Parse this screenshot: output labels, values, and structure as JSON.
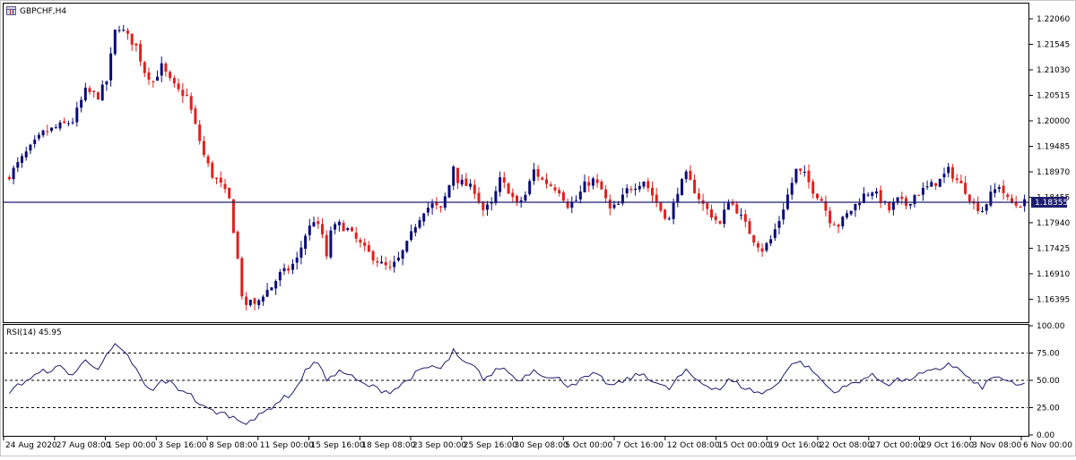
{
  "window": {
    "title": "GBPCHF,H4",
    "icon": "chart-window-icon"
  },
  "colors": {
    "bull": "#0b0b7d",
    "bear": "#e0201c",
    "line": "#1c1c6e",
    "frame": "#000000",
    "bg": "#ffffff",
    "current_price_bg": "#1c1c6e",
    "current_price_text": "#ffffff"
  },
  "chart_data": [
    {
      "type": "candlestick",
      "title": "GBPCHF,H4",
      "symbol": "GBPCHF",
      "timeframe": "H4",
      "ylim": [
        1.1595,
        1.2235
      ],
      "y_ticks": [
        "1.22060",
        "1.21545",
        "1.21030",
        "1.20515",
        "1.20000",
        "1.19485",
        "1.18970",
        "1.18455",
        "1.17940",
        "1.17425",
        "1.16910",
        "1.16395"
      ],
      "current_price": 1.18355,
      "current_price_label": "1.18355",
      "grid": false,
      "x_ticks": [
        "24 Aug 2020",
        "27 Aug 08:00",
        "1 Sep 00:00",
        "3 Sep 16:00",
        "8 Sep 08:00",
        "11 Sep 00:00",
        "15 Sep 16:00",
        "18 Sep 08:00",
        "23 Sep 00:00",
        "25 Sep 16:00",
        "30 Sep 08:00",
        "5 Oct 00:00",
        "7 Oct 16:00",
        "12 Oct 08:00",
        "15 Oct 00:00",
        "19 Oct 16:00",
        "22 Oct 08:00",
        "27 Oct 00:00",
        "29 Oct 16:00",
        "3 Nov 08:00",
        "6 Nov 00:00"
      ],
      "close_path": [
        [
          0,
          1.189
        ],
        [
          4,
          1.1935
        ],
        [
          8,
          1.1975
        ],
        [
          12,
          1.199
        ],
        [
          15,
          1.2
        ],
        [
          18,
          1.206
        ],
        [
          21,
          1.205
        ],
        [
          23,
          1.208
        ],
        [
          25,
          1.218
        ],
        [
          26,
          1.219
        ],
        [
          28,
          1.217
        ],
        [
          30,
          1.215
        ],
        [
          32,
          1.21
        ],
        [
          34,
          1.208
        ],
        [
          36,
          1.211
        ],
        [
          38,
          1.208
        ],
        [
          40,
          1.206
        ],
        [
          42,
          1.205
        ],
        [
          44,
          1.199
        ],
        [
          46,
          1.193
        ],
        [
          48,
          1.189
        ],
        [
          50,
          1.187
        ],
        [
          52,
          1.184
        ],
        [
          54,
          1.172
        ],
        [
          55,
          1.165
        ],
        [
          56,
          1.162
        ],
        [
          57,
          1.164
        ],
        [
          58,
          1.1625
        ],
        [
          60,
          1.165
        ],
        [
          62,
          1.1665
        ],
        [
          64,
          1.169
        ],
        [
          66,
          1.17
        ],
        [
          68,
          1.172
        ],
        [
          70,
          1.177
        ],
        [
          72,
          1.18
        ],
        [
          74,
          1.177
        ],
        [
          75,
          1.172
        ],
        [
          76,
          1.178
        ],
        [
          78,
          1.179
        ],
        [
          80,
          1.178
        ],
        [
          82,
          1.176
        ],
        [
          84,
          1.174
        ],
        [
          86,
          1.1725
        ],
        [
          88,
          1.171
        ],
        [
          90,
          1.17
        ],
        [
          92,
          1.172
        ],
        [
          94,
          1.175
        ],
        [
          96,
          1.179
        ],
        [
          98,
          1.182
        ],
        [
          100,
          1.183
        ],
        [
          102,
          1.182
        ],
        [
          104,
          1.187
        ],
        [
          105,
          1.191
        ],
        [
          106,
          1.188
        ],
        [
          108,
          1.187
        ],
        [
          110,
          1.186
        ],
        [
          112,
          1.182
        ],
        [
          114,
          1.183
        ],
        [
          116,
          1.188
        ],
        [
          118,
          1.186
        ],
        [
          120,
          1.183
        ],
        [
          122,
          1.185
        ],
        [
          124,
          1.19
        ],
        [
          126,
          1.188
        ],
        [
          128,
          1.187
        ],
        [
          130,
          1.186
        ],
        [
          132,
          1.183
        ],
        [
          134,
          1.184
        ],
        [
          136,
          1.187
        ],
        [
          138,
          1.188
        ],
        [
          140,
          1.186
        ],
        [
          142,
          1.182
        ],
        [
          144,
          1.183
        ],
        [
          146,
          1.186
        ],
        [
          148,
          1.187
        ],
        [
          150,
          1.188
        ],
        [
          152,
          1.185
        ],
        [
          154,
          1.182
        ],
        [
          156,
          1.18
        ],
        [
          158,
          1.186
        ],
        [
          160,
          1.189
        ],
        [
          162,
          1.186
        ],
        [
          164,
          1.183
        ],
        [
          166,
          1.181
        ],
        [
          168,
          1.179
        ],
        [
          170,
          1.184
        ],
        [
          172,
          1.182
        ],
        [
          174,
          1.179
        ],
        [
          176,
          1.176
        ],
        [
          178,
          1.174
        ],
        [
          180,
          1.176
        ],
        [
          182,
          1.18
        ],
        [
          184,
          1.185
        ],
        [
          186,
          1.19
        ],
        [
          188,
          1.189
        ],
        [
          190,
          1.186
        ],
        [
          192,
          1.184
        ],
        [
          194,
          1.18
        ],
        [
          196,
          1.179
        ],
        [
          198,
          1.181
        ],
        [
          200,
          1.183
        ],
        [
          202,
          1.185
        ],
        [
          204,
          1.186
        ],
        [
          206,
          1.184
        ],
        [
          208,
          1.182
        ],
        [
          210,
          1.184
        ],
        [
          212,
          1.183
        ],
        [
          214,
          1.185
        ],
        [
          216,
          1.186
        ],
        [
          218,
          1.187
        ],
        [
          220,
          1.188
        ],
        [
          222,
          1.19
        ],
        [
          224,
          1.188
        ],
        [
          226,
          1.186
        ],
        [
          228,
          1.183
        ],
        [
          230,
          1.182
        ],
        [
          232,
          1.185
        ],
        [
          234,
          1.187
        ],
        [
          236,
          1.184
        ],
        [
          238,
          1.183
        ],
        [
          240,
          1.1835
        ]
      ]
    },
    {
      "type": "line",
      "title": "RSI(14) 45.95",
      "indicator": "RSI",
      "period": 14,
      "current_value": 45.95,
      "ylim": [
        0,
        100
      ],
      "y_ticks": [
        "100.00",
        "75.00",
        "50.00",
        "25.00",
        "0.00"
      ],
      "levels": [
        75,
        50,
        25
      ],
      "path": [
        [
          0,
          40
        ],
        [
          4,
          50
        ],
        [
          8,
          58
        ],
        [
          12,
          62
        ],
        [
          15,
          55
        ],
        [
          18,
          68
        ],
        [
          21,
          62
        ],
        [
          23,
          72
        ],
        [
          25,
          82
        ],
        [
          26,
          78
        ],
        [
          28,
          72
        ],
        [
          30,
          60
        ],
        [
          32,
          45
        ],
        [
          34,
          40
        ],
        [
          36,
          50
        ],
        [
          38,
          48
        ],
        [
          40,
          42
        ],
        [
          42,
          40
        ],
        [
          44,
          32
        ],
        [
          46,
          25
        ],
        [
          48,
          22
        ],
        [
          50,
          20
        ],
        [
          52,
          18
        ],
        [
          54,
          14
        ],
        [
          55,
          13
        ],
        [
          56,
          12
        ],
        [
          57,
          15
        ],
        [
          58,
          14
        ],
        [
          60,
          20
        ],
        [
          62,
          26
        ],
        [
          64,
          32
        ],
        [
          66,
          36
        ],
        [
          68,
          44
        ],
        [
          70,
          58
        ],
        [
          72,
          68
        ],
        [
          74,
          60
        ],
        [
          75,
          47
        ],
        [
          76,
          55
        ],
        [
          78,
          58
        ],
        [
          80,
          56
        ],
        [
          82,
          50
        ],
        [
          84,
          46
        ],
        [
          86,
          44
        ],
        [
          88,
          41
        ],
        [
          90,
          40
        ],
        [
          92,
          44
        ],
        [
          94,
          50
        ],
        [
          96,
          56
        ],
        [
          98,
          60
        ],
        [
          100,
          63
        ],
        [
          102,
          60
        ],
        [
          104,
          70
        ],
        [
          105,
          78
        ],
        [
          106,
          70
        ],
        [
          108,
          65
        ],
        [
          110,
          62
        ],
        [
          112,
          52
        ],
        [
          114,
          55
        ],
        [
          116,
          62
        ],
        [
          118,
          58
        ],
        [
          120,
          50
        ],
        [
          122,
          54
        ],
        [
          124,
          60
        ],
        [
          126,
          56
        ],
        [
          128,
          52
        ],
        [
          130,
          51
        ],
        [
          132,
          46
        ],
        [
          134,
          48
        ],
        [
          136,
          52
        ],
        [
          138,
          55
        ],
        [
          140,
          52
        ],
        [
          142,
          45
        ],
        [
          144,
          47
        ],
        [
          146,
          51
        ],
        [
          148,
          54
        ],
        [
          150,
          56
        ],
        [
          152,
          50
        ],
        [
          154,
          45
        ],
        [
          156,
          42
        ],
        [
          158,
          52
        ],
        [
          160,
          58
        ],
        [
          162,
          52
        ],
        [
          164,
          47
        ],
        [
          166,
          44
        ],
        [
          168,
          42
        ],
        [
          170,
          50
        ],
        [
          172,
          47
        ],
        [
          174,
          43
        ],
        [
          176,
          40
        ],
        [
          178,
          38
        ],
        [
          180,
          42
        ],
        [
          182,
          50
        ],
        [
          184,
          60
        ],
        [
          186,
          68
        ],
        [
          188,
          64
        ],
        [
          190,
          58
        ],
        [
          192,
          50
        ],
        [
          194,
          42
        ],
        [
          196,
          40
        ],
        [
          198,
          45
        ],
        [
          200,
          48
        ],
        [
          202,
          52
        ],
        [
          204,
          54
        ],
        [
          206,
          50
        ],
        [
          208,
          47
        ],
        [
          210,
          51
        ],
        [
          212,
          49
        ],
        [
          214,
          54
        ],
        [
          216,
          56
        ],
        [
          218,
          58
        ],
        [
          220,
          60
        ],
        [
          222,
          66
        ],
        [
          224,
          61
        ],
        [
          226,
          55
        ],
        [
          228,
          47
        ],
        [
          230,
          44
        ],
        [
          232,
          51
        ],
        [
          234,
          54
        ],
        [
          236,
          48
        ],
        [
          238,
          45
        ],
        [
          240,
          46
        ]
      ]
    }
  ]
}
